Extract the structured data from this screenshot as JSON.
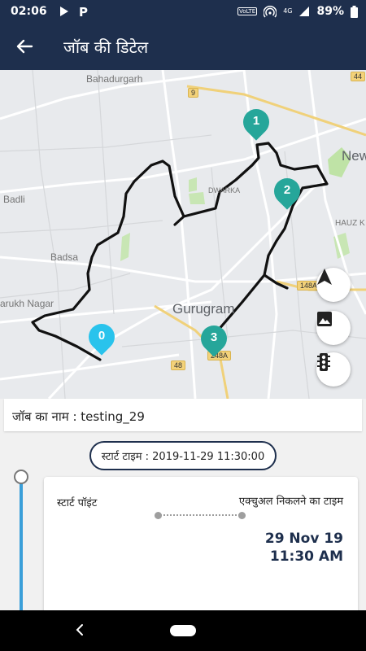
{
  "status_bar": {
    "time": "02:06",
    "volte": "VoLTE",
    "network": "4G",
    "battery": "89%"
  },
  "app_bar": {
    "title": "जॉब की डिटेल"
  },
  "map": {
    "labels": {
      "bahadurgarh": "Bahadurgarh",
      "new": "New",
      "dwarka": "DWARKA",
      "badli": "Badli",
      "hauz_k": "HAUZ K",
      "badsa": "Badsa",
      "gurugram": "Gurugram",
      "farukh_nagar": "arukh Nagar"
    },
    "road_shields": {
      "r9": "9",
      "r44": "44",
      "r148a": "148A",
      "r248a": "248A",
      "r48": "48"
    },
    "markers": [
      {
        "label": "1",
        "color": "#26a69a"
      },
      {
        "label": "2",
        "color": "#26a69a"
      },
      {
        "label": "3",
        "color": "#26a69a"
      },
      {
        "label": "0",
        "color": "#29c3ec"
      }
    ]
  },
  "job": {
    "name_label": "जॉब का नाम : testing_29"
  },
  "start_time": {
    "label": "स्टार्ट टाइम : 2019-11-29 11:30:00"
  },
  "detail": {
    "start_point_label": "स्टार्ट पॉइंट",
    "exit_label": "एक्चुअल निकलने का टाइम",
    "exit_date": "29 Nov 19",
    "exit_time": "11:30 AM"
  },
  "colors": {
    "primary": "#1e2f4d",
    "timeline": "#3a9fd9",
    "marker_teal": "#26a69a",
    "marker_cyan": "#29c3ec"
  }
}
